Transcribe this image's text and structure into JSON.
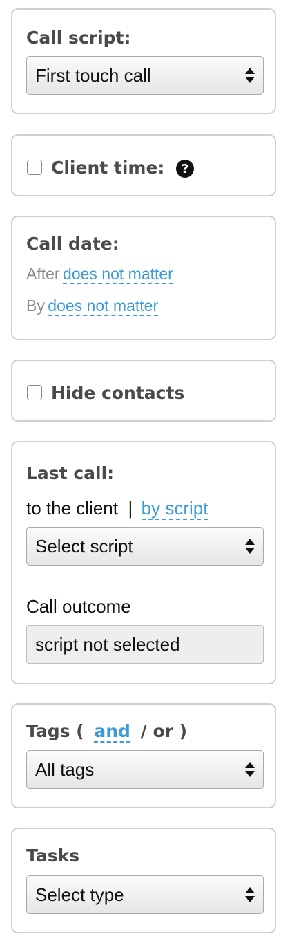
{
  "call_script": {
    "title": "Call script:",
    "selected": "First touch call"
  },
  "client_time": {
    "label": "Client time:",
    "help_icon": "question-circle-icon",
    "checked": false
  },
  "call_date": {
    "title": "Call date:",
    "after_label": "After",
    "after_value": "does not matter",
    "by_label": "By",
    "by_value": "does not matter"
  },
  "hide_contacts": {
    "label": "Hide contacts",
    "checked": false
  },
  "last_call": {
    "title": "Last call:",
    "option_client": "to the client",
    "separator": "|",
    "option_script": "by script",
    "script_selected": "Select script",
    "outcome_label": "Call outcome",
    "outcome_value": "script not selected"
  },
  "tags": {
    "title_prefix": "Tags (",
    "and_label": "and",
    "or_label": "/ or )",
    "selected": "All tags"
  },
  "tasks": {
    "title": "Tasks",
    "selected": "Select type"
  },
  "colors": {
    "link": "#3a9bd8",
    "border": "#cfcfcf",
    "heading": "#4a4a4a"
  }
}
